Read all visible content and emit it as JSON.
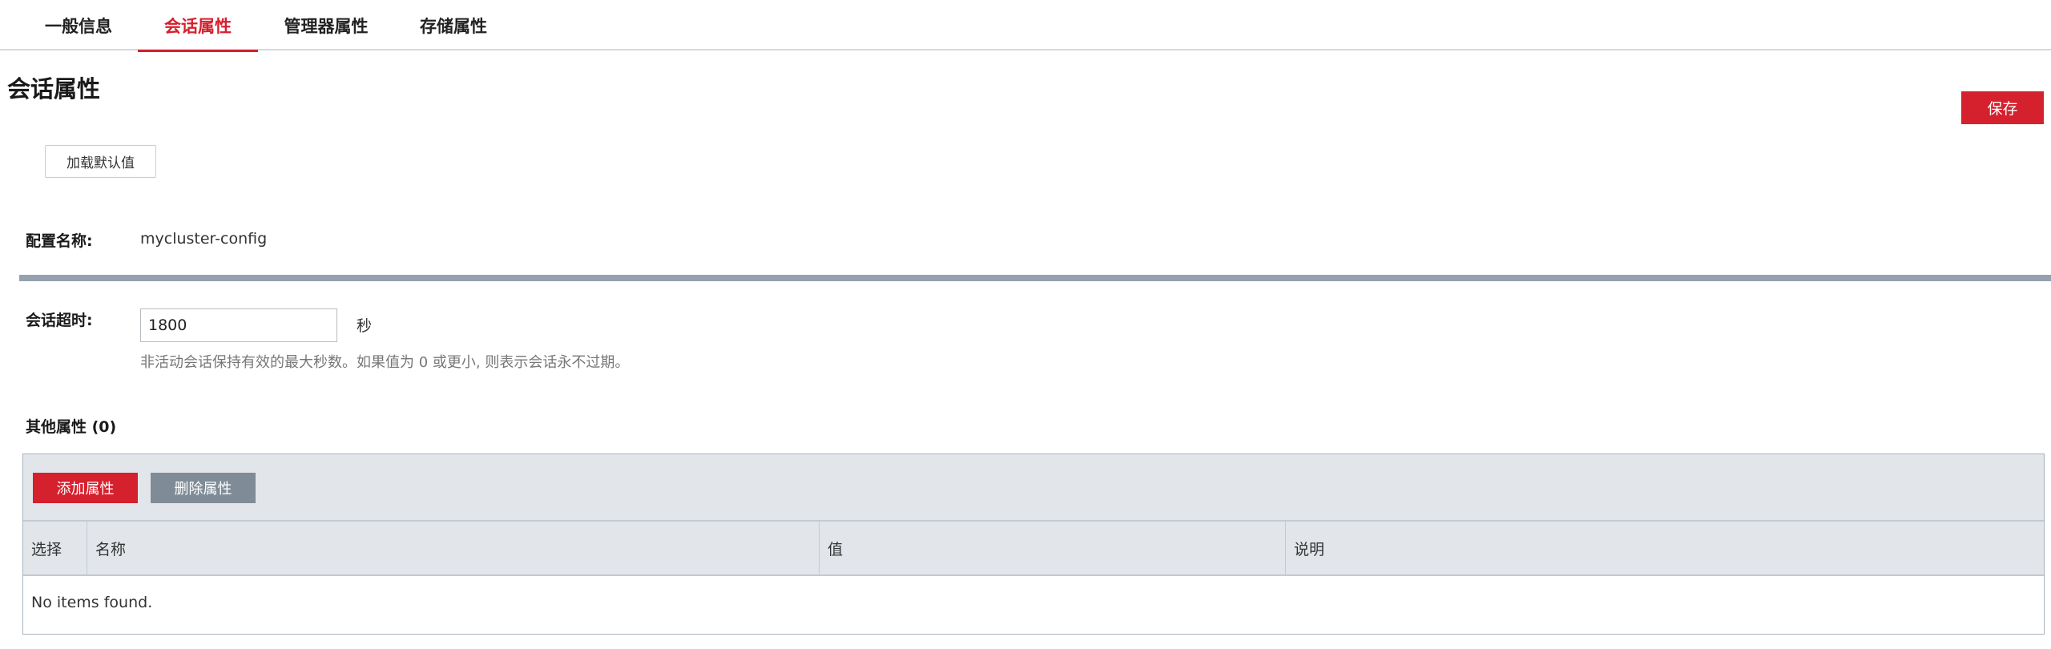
{
  "tabs": [
    {
      "label": "一般信息",
      "active": false
    },
    {
      "label": "会话属性",
      "active": true
    },
    {
      "label": "管理器属性",
      "active": false
    },
    {
      "label": "存储属性",
      "active": false
    }
  ],
  "page_title": "会话属性",
  "save_label": "保存",
  "load_defaults_label": "加载默认值",
  "config": {
    "label": "配置名称:",
    "value": "mycluster-config"
  },
  "timeout": {
    "label": "会话超时:",
    "value": "1800",
    "unit": "秒",
    "hint": "非活动会话保持有效的最大秒数。如果值为 0 或更小, 则表示会话永不过期。"
  },
  "other_props": {
    "title": "其他属性 (0)",
    "add_label": "添加属性",
    "delete_label": "删除属性",
    "columns": [
      "选择",
      "名称",
      "值",
      "说明"
    ],
    "empty_text": "No items found."
  },
  "colors": {
    "accent": "#d5202e",
    "divider": "#95a1ad",
    "secondary_button": "#7f8c97",
    "table_header": "#e2e6ea"
  }
}
